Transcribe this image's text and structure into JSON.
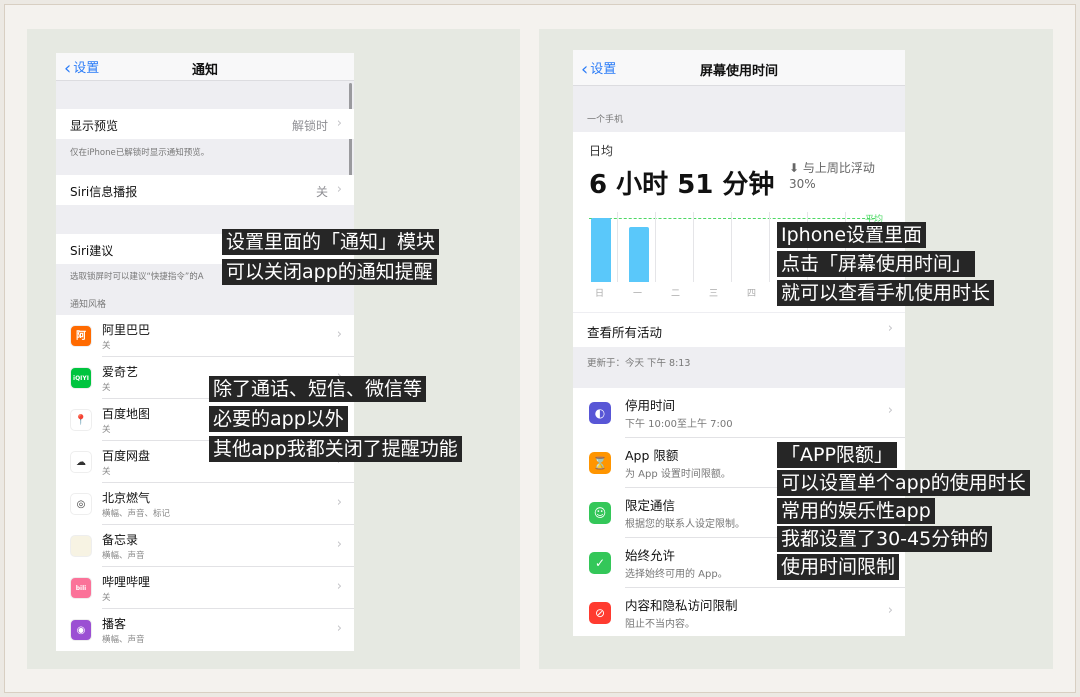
{
  "left_screen": {
    "nav": {
      "back_label": "设置",
      "title": "通知"
    },
    "rows": [
      {
        "label": "显示预览",
        "value": "解锁时"
      },
      {
        "label": "Siri信息播报",
        "value": "关"
      },
      {
        "label": "Siri建议",
        "value": ""
      }
    ],
    "preview_note": "仅在iPhone已解锁时显示通知预览。",
    "siri_note": "选取锁屏时可以建议“快捷指令”的A",
    "section_title": "通知风格",
    "apps": [
      {
        "name": "阿里巴巴",
        "sub": "关",
        "icon": "alibaba-icon",
        "color": "#ff6a00",
        "glyph": "阿"
      },
      {
        "name": "爱奇艺",
        "sub": "关",
        "icon": "iqiyi-icon",
        "color": "#00c43f",
        "glyph": "iQIYI"
      },
      {
        "name": "百度地图",
        "sub": "关",
        "icon": "baidu-map-icon",
        "color": "#ffffff",
        "glyph": "📍"
      },
      {
        "name": "百度网盘",
        "sub": "关",
        "icon": "baidu-netdisk-icon",
        "color": "#ffffff",
        "glyph": "☁"
      },
      {
        "name": "北京燃气",
        "sub": "横幅、声音、标记",
        "icon": "beijing-gas-icon",
        "color": "#ffffff",
        "glyph": "◎"
      },
      {
        "name": "备忘录",
        "sub": "横幅、声音",
        "icon": "notes-icon",
        "color": "#f7f3e3",
        "glyph": ""
      },
      {
        "name": "哔哩哔哩",
        "sub": "关",
        "icon": "bilibili-icon",
        "color": "#fb7299",
        "glyph": "bili"
      },
      {
        "name": "播客",
        "sub": "横幅、声音",
        "icon": "podcasts-icon",
        "color": "#9b4fd3",
        "glyph": "◉"
      }
    ]
  },
  "right_screen": {
    "nav": {
      "back_label": "设置",
      "title": "屏幕使用时间"
    },
    "device_label": "一个手机",
    "daily_avg_label": "日均",
    "daily_avg_value": "6 小时 51 分钟",
    "compare_label": "与上周比浮动",
    "compare_value": "30%",
    "avg_tag": "平均",
    "weekday_labels": [
      "日",
      "一",
      "二",
      "三",
      "四"
    ],
    "weekday_bars": [
      0.92,
      0.78,
      0,
      0,
      0
    ],
    "see_all": "查看所有活动",
    "updated": "更新于：今天 下午 8:13",
    "items": [
      {
        "title": "停用时间",
        "sub": "下午 10:00至上午 7:00",
        "icon": "downtime-icon",
        "color": "#5856d6",
        "glyph": "◐"
      },
      {
        "title": "App 限额",
        "sub": "为 App 设置时间限额。",
        "icon": "hourglass-icon",
        "color": "#ff9500",
        "glyph": "⌛"
      },
      {
        "title": "限定通信",
        "sub": "根据您的联系人设定限制。",
        "icon": "contacts-icon",
        "color": "#34c759",
        "glyph": "☺"
      },
      {
        "title": "始终允许",
        "sub": "选择始终可用的 App。",
        "icon": "checkmark-icon",
        "color": "#34c759",
        "glyph": "✓"
      },
      {
        "title": "内容和隐私访问限制",
        "sub": "阻止不当内容。",
        "icon": "restriction-icon",
        "color": "#ff3b30",
        "glyph": "⊘"
      }
    ]
  },
  "captions": {
    "notify": [
      "设置里面的「通知」模块",
      "可以关闭app的通知提醒"
    ],
    "apps": [
      "除了通话、短信、微信等",
      "必要的app以外",
      "其他app我都关闭了提醒功能"
    ],
    "screentime": [
      "Iphone设置里面",
      "点击「屏幕使用时间」",
      "就可以查看手机使用时长"
    ],
    "limits": [
      "「APP限额」",
      "可以设置单个app的使用时长",
      "常用的娱乐性app",
      "我都设置了30-45分钟的",
      "使用时间限制"
    ]
  }
}
